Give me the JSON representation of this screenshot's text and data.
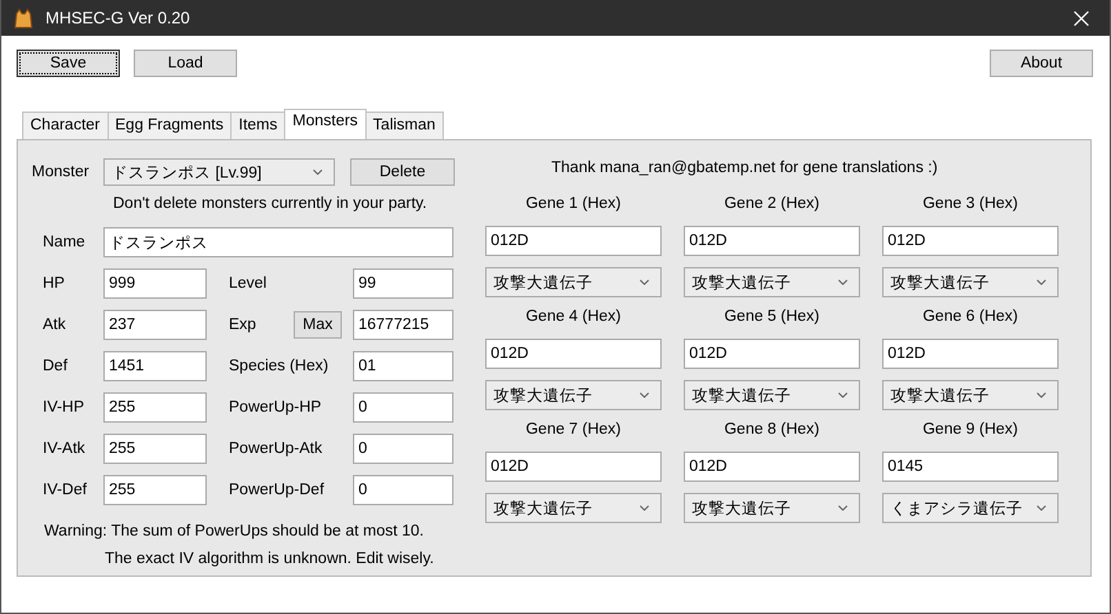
{
  "window": {
    "title": "MHSEC-G Ver 0.20"
  },
  "toolbar": {
    "buttons": [
      {
        "label": "Save",
        "focused": true
      },
      {
        "label": "Load",
        "focused": false
      }
    ],
    "about": "About"
  },
  "tabs": [
    {
      "label": "Character",
      "selected": false
    },
    {
      "label": "Egg Fragments",
      "selected": false
    },
    {
      "label": "Items",
      "selected": false
    },
    {
      "label": "Monsters",
      "selected": true
    },
    {
      "label": "Talisman",
      "selected": false
    }
  ],
  "monster": {
    "label": "Monster",
    "selected_value": "ドスランポス [Lv.99]",
    "delete": "Delete",
    "note": "Don't delete monsters currently in your party.",
    "name": {
      "label": "Name",
      "value": "ドスランポス"
    },
    "rows": [
      {
        "left": {
          "label": "HP",
          "value": "999"
        },
        "right": {
          "label": "Level",
          "value": "99"
        }
      },
      {
        "left": {
          "label": "Atk",
          "value": "237"
        },
        "right": {
          "label": "Exp",
          "action": "Max",
          "value": "16777215"
        }
      },
      {
        "left": {
          "label": "Def",
          "value": "1451"
        },
        "right": {
          "label": "Species (Hex)",
          "value": "01"
        }
      },
      {
        "left": {
          "label": "IV-HP",
          "value": "255"
        },
        "right": {
          "label": "PowerUp-HP",
          "value": "0"
        }
      },
      {
        "left": {
          "label": "IV-Atk",
          "value": "255"
        },
        "right": {
          "label": "PowerUp-Atk",
          "value": "0"
        }
      },
      {
        "left": {
          "label": "IV-Def",
          "value": "255"
        },
        "right": {
          "label": "PowerUp-Def",
          "value": "0"
        }
      }
    ],
    "warnings": [
      "Warning: The sum of PowerUps should be at most 10.",
      "The exact IV algorithm is unknown. Edit wisely."
    ]
  },
  "genes": {
    "credit": "Thank mana_ran@gbatemp.net for gene translations :)",
    "items": [
      {
        "label": "Gene 1 (Hex)",
        "value": "012D",
        "type": "攻撃大遺伝子"
      },
      {
        "label": "Gene 2 (Hex)",
        "value": "012D",
        "type": "攻撃大遺伝子"
      },
      {
        "label": "Gene 3 (Hex)",
        "value": "012D",
        "type": "攻撃大遺伝子"
      },
      {
        "label": "Gene 4 (Hex)",
        "value": "012D",
        "type": "攻撃大遺伝子"
      },
      {
        "label": "Gene 5 (Hex)",
        "value": "012D",
        "type": "攻撃大遺伝子"
      },
      {
        "label": "Gene 6 (Hex)",
        "value": "012D",
        "type": "攻撃大遺伝子"
      },
      {
        "label": "Gene 7 (Hex)",
        "value": "012D",
        "type": "攻撃大遺伝子"
      },
      {
        "label": "Gene 8 (Hex)",
        "value": "012D",
        "type": "攻撃大遺伝子"
      },
      {
        "label": "Gene 9 (Hex)",
        "value": "0145",
        "type": "くまアシラ遺伝子"
      }
    ]
  }
}
